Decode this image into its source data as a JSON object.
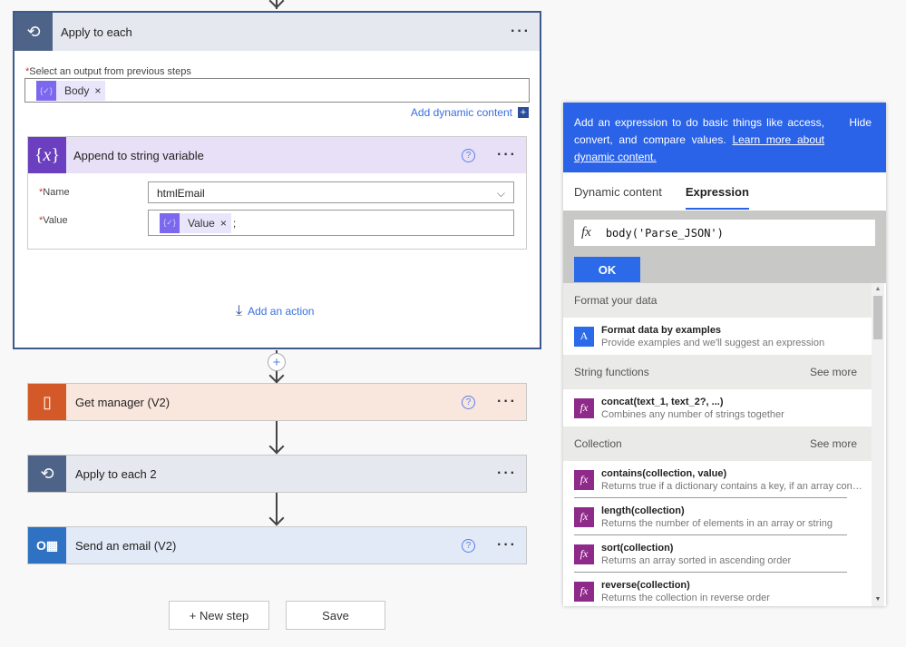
{
  "apply_each": {
    "title": "Apply to each",
    "select_label": "Select an output from previous steps",
    "token": "Body",
    "add_dynamic": "Add dynamic content",
    "add_action": "Add an action"
  },
  "append": {
    "title": "Append to string variable",
    "name_label": "Name",
    "name_value": "htmlEmail",
    "value_label": "Value",
    "value_token": "Value",
    "value_suffix": ";"
  },
  "steps": [
    {
      "title": "Get manager (V2)",
      "icon": "office-icon",
      "color": "#d35a28"
    },
    {
      "title": "Apply to each 2",
      "icon": "loop-icon",
      "color": "#4d6488"
    },
    {
      "title": "Send an email (V2)",
      "icon": "outlook-icon",
      "color": "#2f72c4"
    }
  ],
  "buttons": {
    "new_step": "+ New step",
    "save": "Save"
  },
  "panel": {
    "info": "Add an expression to do basic things like access, convert, and compare values.",
    "learn_more": "Learn more about dynamic content.",
    "hide": "Hide",
    "tabs": [
      "Dynamic content",
      "Expression"
    ],
    "active_tab": "Expression",
    "expression": "body('Parse_JSON')",
    "ok": "OK",
    "sections": [
      {
        "title": "Format your data",
        "see_more": "",
        "items": [
          {
            "name": "Format data by examples",
            "desc": "Provide examples and we'll suggest an expression"
          }
        ]
      },
      {
        "title": "String functions",
        "see_more": "See more",
        "items": [
          {
            "name": "concat(text_1, text_2?, ...)",
            "desc": "Combines any number of strings together"
          }
        ]
      },
      {
        "title": "Collection",
        "see_more": "See more",
        "items": [
          {
            "name": "contains(collection, value)",
            "desc": "Returns true if a dictionary contains a key, if an array contains a value, or if a string contains a substring"
          },
          {
            "name": "length(collection)",
            "desc": "Returns the number of elements in an array or string"
          },
          {
            "name": "sort(collection)",
            "desc": "Returns an array sorted in ascending order"
          },
          {
            "name": "reverse(collection)",
            "desc": "Returns the collection in reverse order"
          }
        ]
      }
    ]
  }
}
